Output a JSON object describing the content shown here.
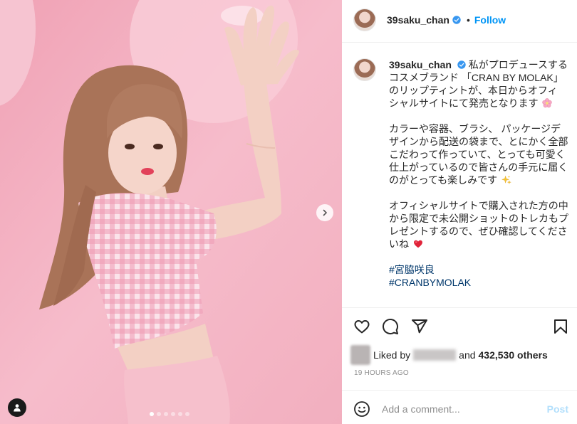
{
  "header": {
    "username": "39saku_chan",
    "separator": "•",
    "follow_label": "Follow"
  },
  "caption": {
    "username": "39saku_chan",
    "paragraphs": [
      {
        "lines": [
          "私がプロデュースする",
          "コスメブランド 「CRAN BY MOLAK」",
          "のリップティントが、本日からオフィ",
          "シャルサイトにて発売となります"
        ],
        "end_emoji": "cherry-blossom-emoji"
      },
      {
        "lines": [
          "カラーや容器、ブラシ、 パッケージデ",
          "ザインから配送の袋まで、とにかく全部",
          "こだわって作っていて、とっても可愛く",
          "仕上がっているので皆さんの手元に届く",
          "のがとっても楽しみです"
        ],
        "end_emoji": "sparkles-emoji"
      },
      {
        "lines": [
          "オフィシャルサイトで購入された方の中",
          "から限定で未公開ショットのトレカもプ",
          "レゼントするので、ぜひ確認してくださ",
          "いね"
        ],
        "end_emoji": "red-heart-emoji"
      }
    ],
    "hashtags": [
      "#宮脇咲良",
      "#CRANBYMOLAK"
    ]
  },
  "actions": {
    "icons": [
      "heart-icon",
      "comment-icon",
      "share-icon",
      "bookmark-icon"
    ]
  },
  "likes": {
    "prefix": "Liked by",
    "conjunction": "and",
    "count_text": "432,530 others"
  },
  "timestamp": "19 HOURS AGO",
  "comment_box": {
    "placeholder": "Add a comment...",
    "post_label": "Post",
    "icon": "smiley-icon"
  },
  "carousel": {
    "total_slides": 6,
    "active_slide": 1,
    "next_icon": "chevron-right-icon",
    "tag_icon": "user-tag-icon"
  },
  "colors": {
    "link_blue": "#0095f6",
    "hashtag": "#00376b",
    "verified": "#3897f0",
    "post_disabled": "#b2dffc",
    "muted_text": "#8e8e8e"
  }
}
